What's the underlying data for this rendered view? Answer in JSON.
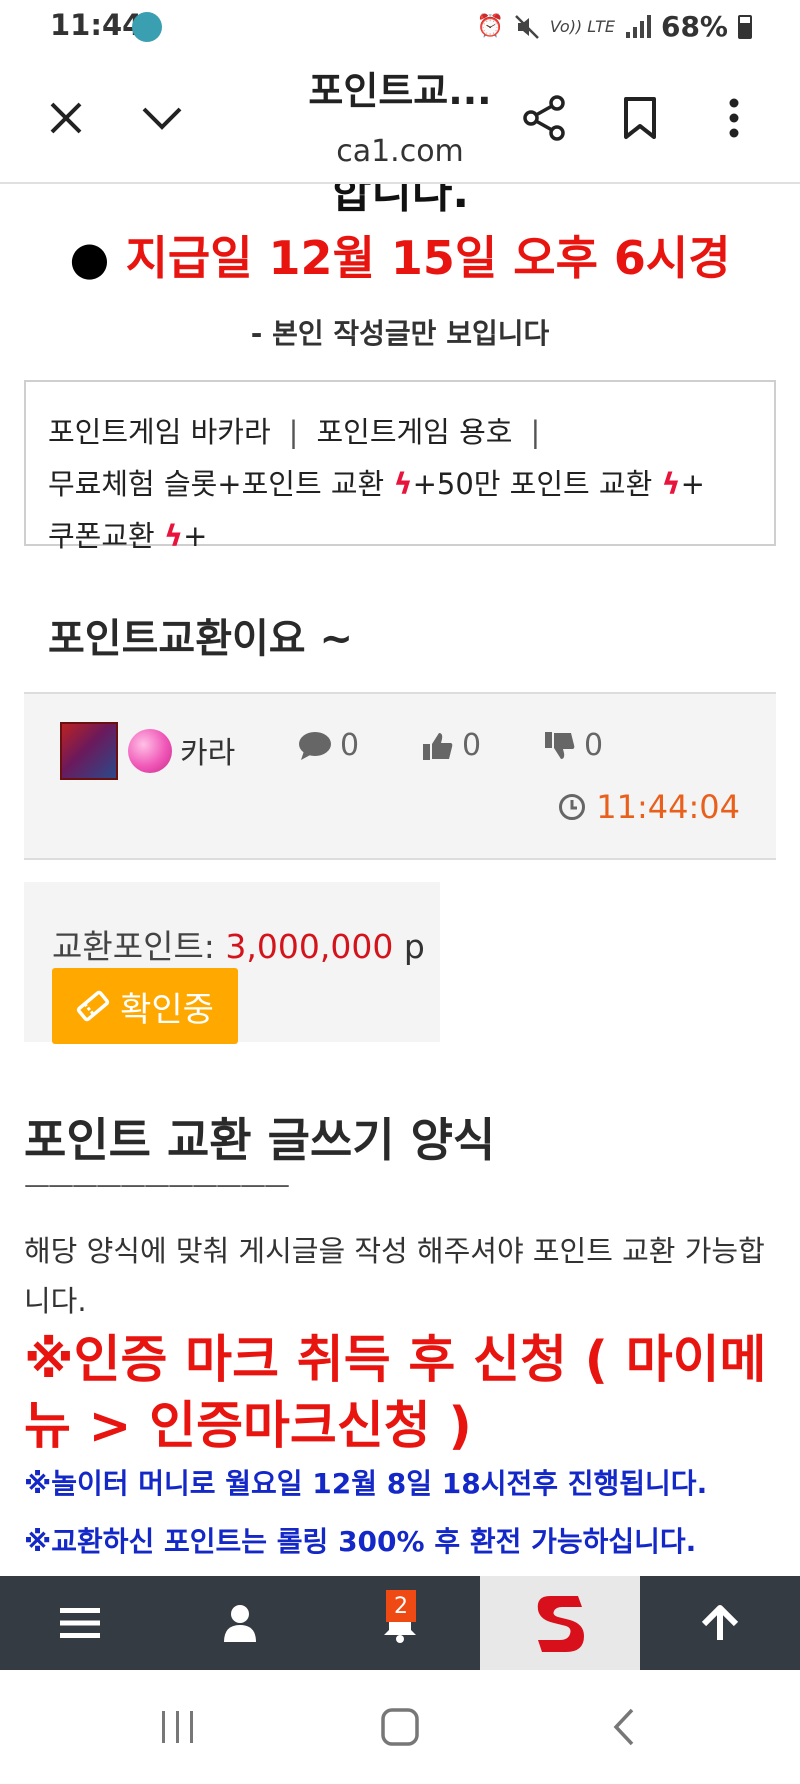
{
  "status_bar": {
    "time": "11:44",
    "network": "LTE",
    "carrier_tag": "Vo)) LTE",
    "battery": "68%",
    "icons": [
      "app-notification-icon",
      "alarm-icon",
      "mute-icon",
      "volte-icon",
      "lte-icon",
      "signal-icon",
      "battery-icon"
    ]
  },
  "browser": {
    "title": "포인트교...",
    "url": "ca1.com",
    "icons": [
      "close-icon",
      "chevron-down-icon",
      "share-icon",
      "bookmark-icon",
      "more-vertical-icon"
    ]
  },
  "content": {
    "cut_heading": "합니다.",
    "pay_date_dot": "●",
    "pay_date": "지급일 12월 15일 오후 6시경",
    "only_mine": "- 본인 작성글만 보입니다",
    "links": {
      "baccarat": "포인트게임 바카라",
      "dragon_tiger": "포인트게임 용호",
      "separator": "|",
      "free_slot": "무료체험 슬롯+포인트 교환",
      "exchange_500k": "+50만 포인트 교환",
      "coupon": "쿠폰교환",
      "bolt": "ϟ",
      "plus": "+"
    },
    "post_title": "포인트교환이요 ~",
    "meta": {
      "author": "카라",
      "comments": "0",
      "likes": "0",
      "dislikes": "0",
      "time": "11:44:04"
    },
    "exchange": {
      "label": "교환포인트: ",
      "value": "3,000,000",
      "unit": " p",
      "status_button": "확인중"
    },
    "form": {
      "title": "포인트 교환 글쓰기 양식",
      "divider": "———————————",
      "description": "해당 양식에 맞춰 게시글을 작성 해주셔야 포인트 교환 가능합니다.",
      "cert_notice": "※인증 마크 취득 후 신청 ( 마이메뉴 > 인증마크신청 )",
      "notice_1": "※놀이터 머니로 월요일 12월 8일 18시전후 진행됩니다.",
      "notice_2": "※교환하신 포인트는 롤링 300% 후 환전 가능하십니다."
    }
  },
  "bottom_nav": {
    "notification_count": "2",
    "logo_letter": "S",
    "icons": [
      "menu-icon",
      "user-icon",
      "bell-icon",
      "site-logo",
      "arrow-up-icon"
    ]
  },
  "colors": {
    "accent_red": "#e8140f",
    "notice_blue": "#1428c8",
    "time_orange": "#e8601c",
    "button_orange": "#ffa800",
    "nav_dark": "#353b42"
  }
}
